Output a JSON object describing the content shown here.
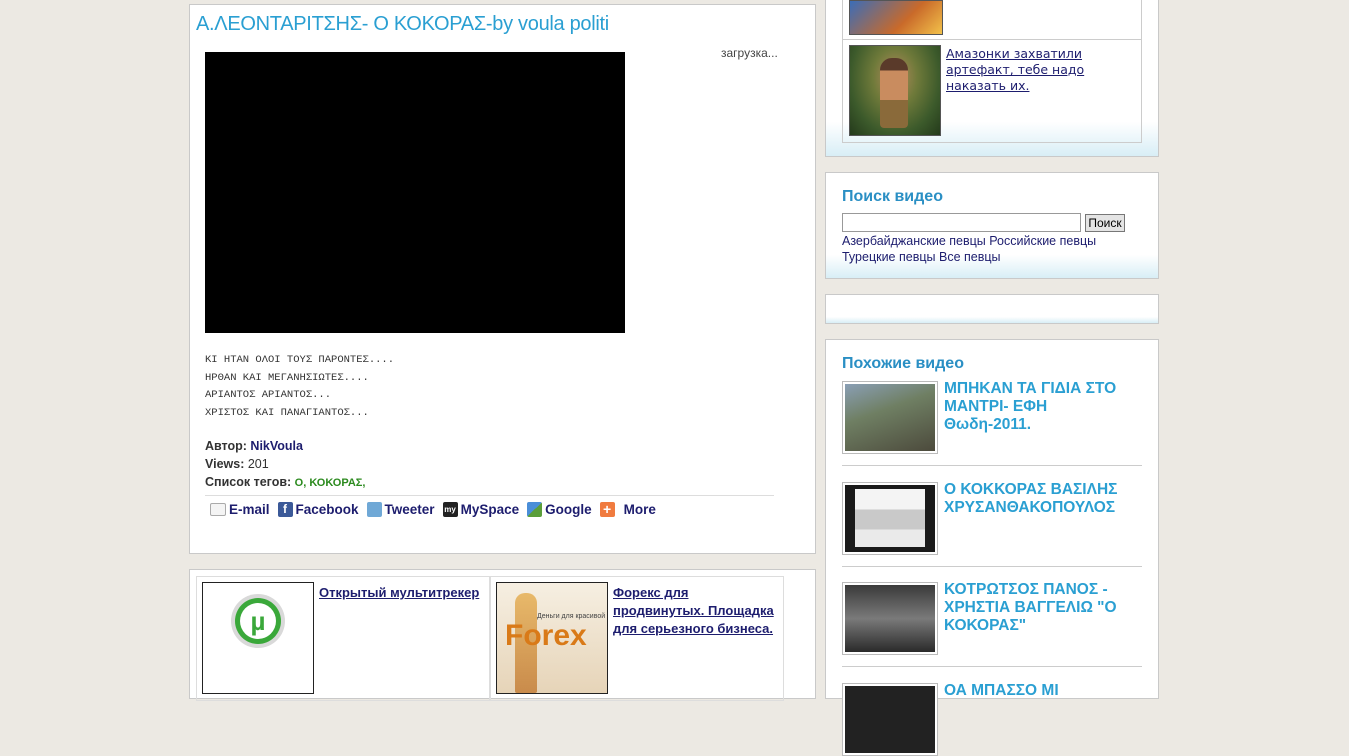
{
  "main": {
    "title": "Α.ΛΕΟΝΤΑΡΙΤΣΗΣ- Ο ΚΟΚΟΡΑΣ-by voula politi",
    "loading_text": "загрузка...",
    "lyrics": [
      "ΚΙ ΗΤΑΝ ΟΛΟΙ ΤΟΥΣ ΠΑΡΟΝΤΕΣ....",
      "ΗΡΘΑΝ ΚΑΙ ΜΕΓΑΝΗΣΙΩΤΕΣ....",
      "ΑΡΙΑΝΤΟΣ ΑΡΙΑΝΤΟΣ...",
      "ΧΡΙΣΤΟΣ ΚΑΙ ΠΑΝΑΓΙΑΝΤΟΣ..."
    ],
    "author_label": "Автор:",
    "author": "NikVoula",
    "views_label": "Views:",
    "views": "201",
    "tags_label": "Список тегов:",
    "tags": "Ο, ΚΟΚΟΡΑΣ,",
    "share": [
      {
        "label": "E-mail",
        "icon": "email-icon",
        "color": "#dddddd"
      },
      {
        "label": "Facebook",
        "icon": "facebook-icon",
        "color": "#3b5998"
      },
      {
        "label": "Tweeter",
        "icon": "twitter-icon",
        "color": "#6fa8d6"
      },
      {
        "label": "MySpace",
        "icon": "myspace-icon",
        "color": "#222222"
      },
      {
        "label": "Google",
        "icon": "google-icon",
        "color": "#5a9e3a"
      },
      {
        "label": "More",
        "icon": "plus-icon",
        "color": "#f07b3f"
      }
    ]
  },
  "ads": [
    {
      "text": "Открытый мультитрекер",
      "icon": "utorrent-icon"
    },
    {
      "text": "Форекс для продвинутых. Площадка для серьезного бизнеса.",
      "icon": "forex-thumb",
      "thumb_caption_small": "Деньги для красивой",
      "thumb_caption_big": "Forex"
    }
  ],
  "promo": {
    "link_text": "Амазонки захватили артефакт, тебе надо наказать их."
  },
  "search": {
    "title": "Поиск видео",
    "button": "Поиск",
    "input_value": "",
    "links": [
      "Азербайджанские певцы",
      "Российские певцы",
      "Турецкие певцы",
      "Все певцы"
    ]
  },
  "similar": {
    "title": "Похожие видео",
    "items": [
      {
        "title": "ΜΠΗΚΑΝ ΤΑ ΓΙΔΙΑ ΣΤΟ ΜΑΝΤΡΙ- ΕΦΗ Θωδη-2011."
      },
      {
        "title": "Ο ΚΟΚΚΟΡΑΣ ΒΑΣΙΛΗΣ ΧΡΥΣΑΝΘΑΚΟΠΟΥΛΟΣ"
      },
      {
        "title": "ΚΟΤΡΩΤΣΟΣ ΠΑΝΟΣ - ΧΡΗΣΤΙΑ ΒΑΓΓΕΛΙΩ \"Ο ΚΟΚΟΡΑΣ\""
      },
      {
        "title": "ΟΑ ΜΠΑΣΣΟ ΜΙ"
      }
    ]
  },
  "colors": {
    "accent_blue": "#2a9fd2",
    "link_navy": "#1d1d6e",
    "tag_green": "#2b8a1e",
    "page_bg": "#ece9e3"
  }
}
